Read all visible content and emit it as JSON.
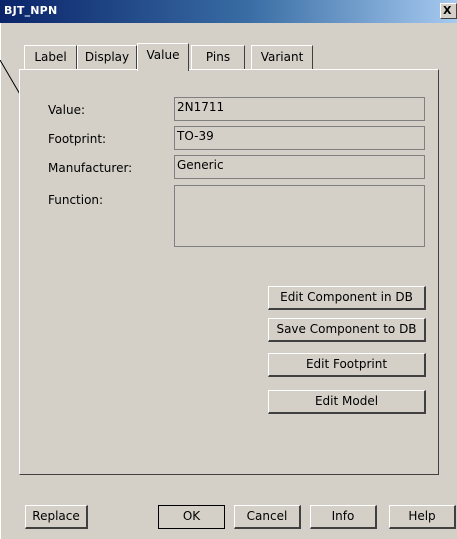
{
  "window": {
    "title": "BJT_NPN",
    "close_glyph": "X"
  },
  "tabs": [
    {
      "label": "Label",
      "active": false
    },
    {
      "label": "Display",
      "active": false
    },
    {
      "label": "Value",
      "active": true
    },
    {
      "label": "Pins",
      "active": false
    },
    {
      "label": "Variant",
      "active": false
    }
  ],
  "fields": {
    "value": {
      "label": "Value:",
      "text": "2N1711"
    },
    "footprint": {
      "label": "Footprint:",
      "text": "TO-39"
    },
    "manufacturer": {
      "label": "Manufacturer:",
      "text": "Generic"
    },
    "function": {
      "label": "Function:",
      "text": ""
    }
  },
  "panel_buttons": {
    "edit_component": "Edit Component in DB",
    "save_component": "Save Component to DB",
    "edit_footprint": "Edit Footprint",
    "edit_model": "Edit Model"
  },
  "footer_buttons": {
    "replace": "Replace",
    "ok": "OK",
    "cancel": "Cancel",
    "info": "Info",
    "help": "Help"
  }
}
